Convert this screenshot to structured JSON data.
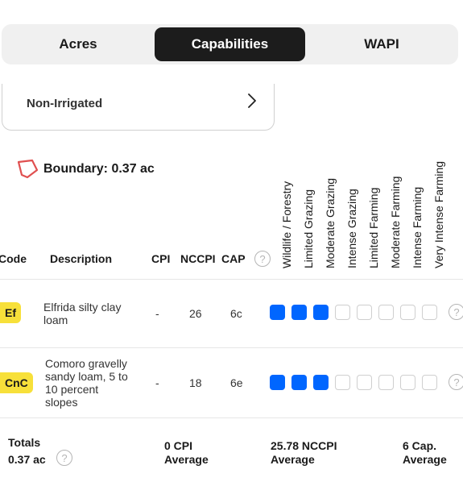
{
  "tabs": [
    {
      "label": "Acres",
      "active": false
    },
    {
      "label": "Capabilities",
      "active": true
    },
    {
      "label": "WAPI",
      "active": false
    }
  ],
  "irrigation": {
    "label": "Non-Irrigated"
  },
  "boundary": {
    "label": "Boundary: 0.37 ac",
    "icon_color": "#e05050"
  },
  "capability_classes": [
    "Wildlife / Forestry",
    "Limited Grazing",
    "Moderate Grazing",
    "Intense Grazing",
    "Limited Farming",
    "Moderate Farming",
    "Intense Farming",
    "Very Intense Farming"
  ],
  "columns": {
    "code": "Code",
    "description": "Description",
    "cpi": "CPI",
    "nccpi": "NCCPI",
    "cap": "CAP"
  },
  "rows": [
    {
      "code": "Ef",
      "description": "Elfrida silty clay loam",
      "cpi": "-",
      "nccpi": "26",
      "cap": "6c",
      "level": 3
    },
    {
      "code": "CnC",
      "description": "Comoro gravelly sandy loam, 5 to 10 percent slopes",
      "cpi": "-",
      "nccpi": "18",
      "cap": "6e",
      "level": 3
    }
  ],
  "totals": {
    "label": "Totals",
    "acres": "0.37 ac",
    "cpi": "0 CPI",
    "cpi_sub": "Average",
    "nccpi": "25.78 NCCPI",
    "nccpi_sub": "Average",
    "cap": "6 Cap.",
    "cap_sub": "Average"
  },
  "colors": {
    "active_square": "#0066ff",
    "badge": "#f7e03a",
    "tab_active": "#1c1c1c"
  }
}
